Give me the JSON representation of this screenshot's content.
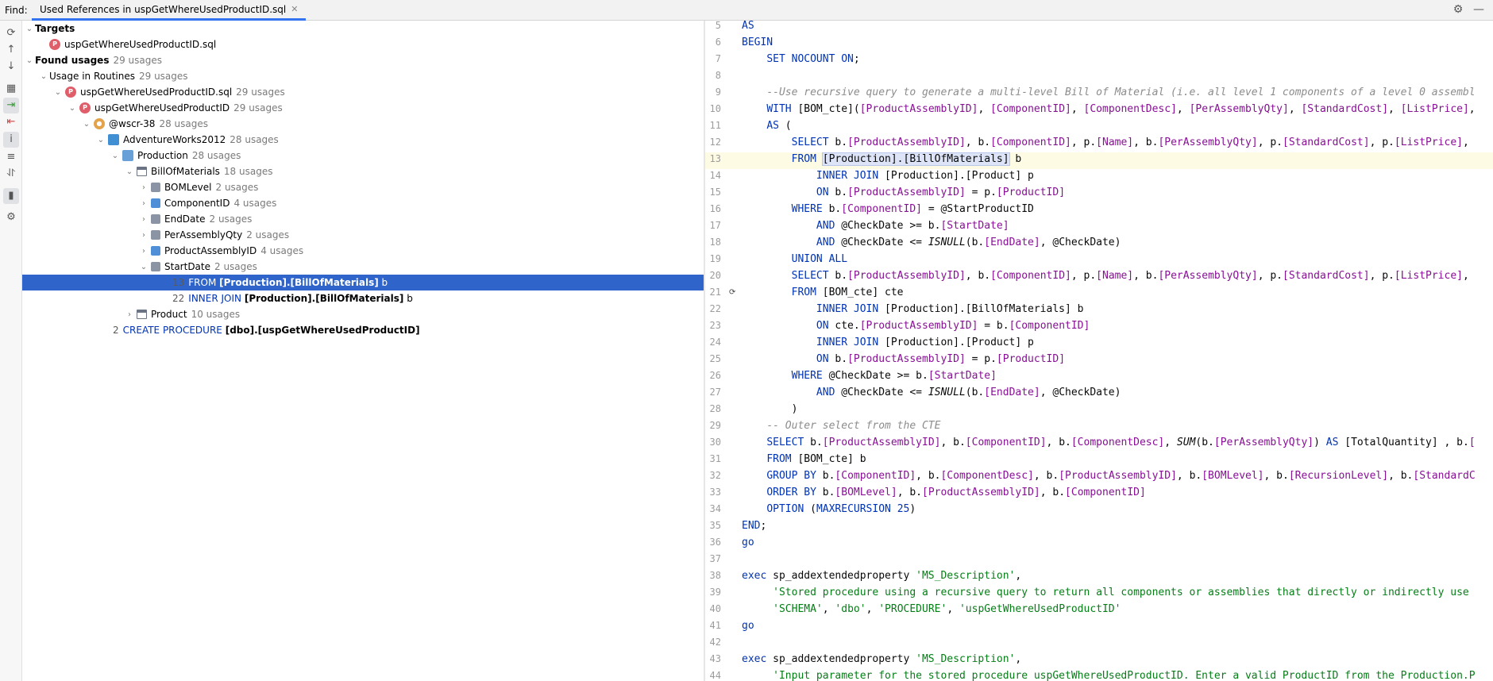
{
  "find_bar": {
    "label": "Find:",
    "tab_title": "Used References in uspGetWhereUsedProductID.sql"
  },
  "toolbar_icons": [
    "refresh-icon",
    "up-arrow-icon",
    "down-arrow-icon",
    "group-icon",
    "navigate-icon",
    "exclude-icon",
    "info-icon",
    "align-icon",
    "merge-icon",
    "preview-icon",
    "settings-icon"
  ],
  "tree": {
    "targets_label": "Targets",
    "target_file": "uspGetWhereUsedProductID.sql",
    "found_label": "Found usages",
    "found_count": "29 usages",
    "routines_label": "Usage in Routines",
    "routines_count": "29 usages",
    "file_label": "uspGetWhereUsedProductID.sql",
    "file_count": "29 usages",
    "proc_label": "uspGetWhereUsedProductID",
    "proc_count": "29 usages",
    "conn_label": "@wscr-38",
    "conn_count": "28 usages",
    "db_label": "AdventureWorks2012",
    "db_count": "28 usages",
    "schema_label": "Production",
    "schema_count": "28 usages",
    "table_label": "BillOfMaterials",
    "table_count": "18 usages",
    "columns": [
      {
        "name": "BOMLevel",
        "count": "2 usages"
      },
      {
        "name": "ComponentID",
        "count": "4 usages"
      },
      {
        "name": "EndDate",
        "count": "2 usages"
      },
      {
        "name": "PerAssemblyQty",
        "count": "2 usages"
      },
      {
        "name": "ProductAssemblyID",
        "count": "4 usages"
      },
      {
        "name": "StartDate",
        "count": "2 usages"
      }
    ],
    "usage1": {
      "line": "13",
      "kw": "FROM",
      "ref": "[Production].[BillOfMaterials]",
      "alias": "b"
    },
    "usage2": {
      "line": "22",
      "kw": "INNER JOIN",
      "ref": "[Production].[BillOfMaterials]",
      "alias": "b"
    },
    "product_label": "Product",
    "product_count": "10 usages",
    "create": {
      "line": "2",
      "kw": "CREATE PROCEDURE",
      "ref": "[dbo].[uspGetWhereUsedProductID]"
    }
  },
  "editor": {
    "current_line": "13",
    "gutter_mark_line": "21"
  }
}
